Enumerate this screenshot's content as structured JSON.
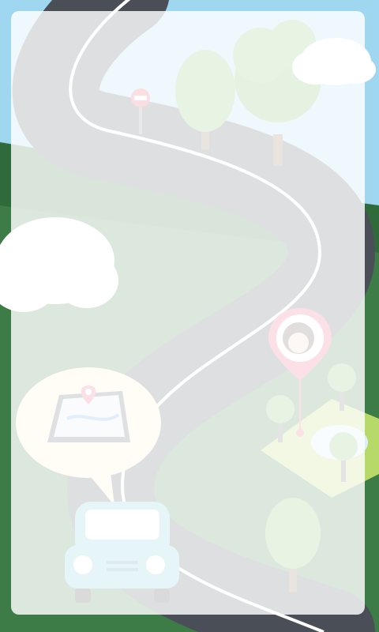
{
  "colors": {
    "sky": "#8fd0ef",
    "grass": "#2f6b3a",
    "road": "#4a4f57",
    "road_line": "#ffffff",
    "pin": "#e9577f",
    "tree": "#7cc36a",
    "car": "#6fc9d6",
    "bubble": "#fff4c6",
    "panel_overlay": "#ffffff"
  },
  "icons": {
    "no_entry_sign": "no-entry-sign-icon",
    "map_pin": "map-pin-icon",
    "tablet_map": "tablet-map-icon",
    "car": "car-icon",
    "tree": "tree-icon",
    "cloud": "cloud-icon"
  }
}
